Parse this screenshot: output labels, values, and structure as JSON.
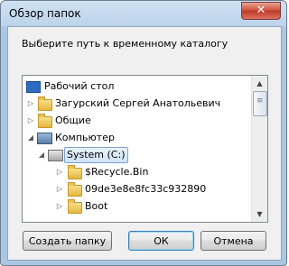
{
  "window": {
    "title": "Обзор папок",
    "close_label": "✕"
  },
  "instruction": "Выберите путь к временному каталогу",
  "tree": {
    "items": [
      {
        "label": "Рабочий стол",
        "icon": "desktop-icon",
        "expander": "",
        "level": 0
      },
      {
        "label": "Загурский Сергей Анатольевич",
        "icon": "user-folder-icon",
        "expander": "▷",
        "level": 1
      },
      {
        "label": "Общие",
        "icon": "folder-icon",
        "expander": "▷",
        "level": 1
      },
      {
        "label": "Компьютер",
        "icon": "computer-icon",
        "expander": "◢",
        "level": 1
      },
      {
        "label": "System (C:)",
        "icon": "drive-icon",
        "expander": "◢",
        "level": 2,
        "selected": true
      },
      {
        "label": "$Recycle.Bin",
        "icon": "folder-icon",
        "expander": "▷",
        "level": 3
      },
      {
        "label": "09de3e8e8fc33c932890",
        "icon": "folder-icon",
        "expander": "▷",
        "level": 3
      },
      {
        "label": "Boot",
        "icon": "folder-icon",
        "expander": "▷",
        "level": 3
      }
    ]
  },
  "buttons": {
    "new_folder": "Создать папку",
    "ok": "ОК",
    "cancel": "Отмена"
  },
  "colors": {
    "title_gradient_top": "#cfe2f3",
    "selection": "#cfe3f8",
    "close": "#c0392b"
  }
}
